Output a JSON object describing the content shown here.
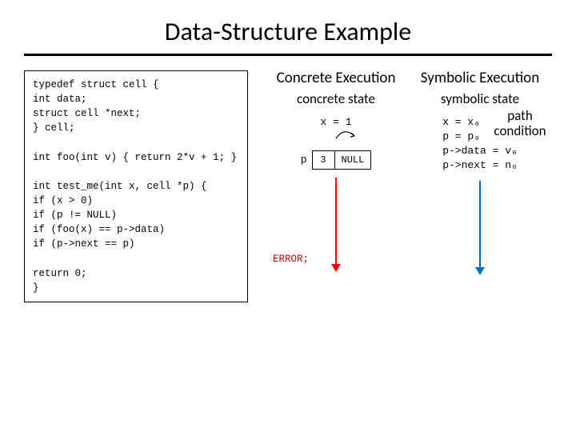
{
  "title": "Data-Structure Example",
  "code": {
    "l1": "typedef struct cell {",
    "l2": "    int data;",
    "l3": "    struct cell *next;",
    "l4": "} cell;",
    "l5": "int foo(int v) { return 2*v + 1; }",
    "l6": "int test_me(int x, cell *p) {",
    "l7": "    if (x > 0)",
    "l8": "        if (p != NULL)",
    "l9": "            if (foo(x) == p->data)",
    "l10": "                if (p->next == p)",
    "l11": "                    ERROR;",
    "l12": "    return 0;",
    "l13": "}"
  },
  "headers": {
    "concrete_exec": "Concrete Execution",
    "symbolic_exec": "Symbolic Execution",
    "concrete_state": "concrete state",
    "symbolic_state": "symbolic state",
    "path_condition": "path condition"
  },
  "concrete": {
    "x": "x = 1",
    "p_label": "p",
    "cell_data": "3",
    "cell_next": "NULL"
  },
  "symbolic": {
    "s1": "x = x₀",
    "s2": "p = p₀",
    "s3": "p->data = v₀",
    "s4": "p->next = n₀"
  }
}
